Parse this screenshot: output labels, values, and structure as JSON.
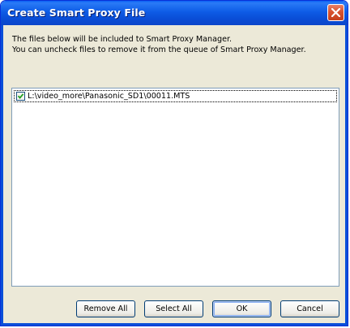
{
  "window": {
    "title": "Create Smart Proxy File"
  },
  "message": {
    "line1": "The files below will be included to Smart Proxy Manager.",
    "line2": "You can uncheck files to remove it from the queue of Smart Proxy Manager."
  },
  "file_list": {
    "items": [
      {
        "checked": true,
        "path": "L:\\video_more\\Panasonic_SD1\\00011.MTS"
      }
    ]
  },
  "buttons": {
    "remove_all": "Remove All",
    "select_all": "Select All",
    "ok": "OK",
    "cancel": "Cancel"
  },
  "colors": {
    "titlebar": "#0a4fd8",
    "dialog_bg": "#ece9d8",
    "close_button": "#d8532f",
    "checkmark": "#21a121"
  },
  "icons": {
    "close": "close-icon",
    "check": "checkmark-icon"
  }
}
